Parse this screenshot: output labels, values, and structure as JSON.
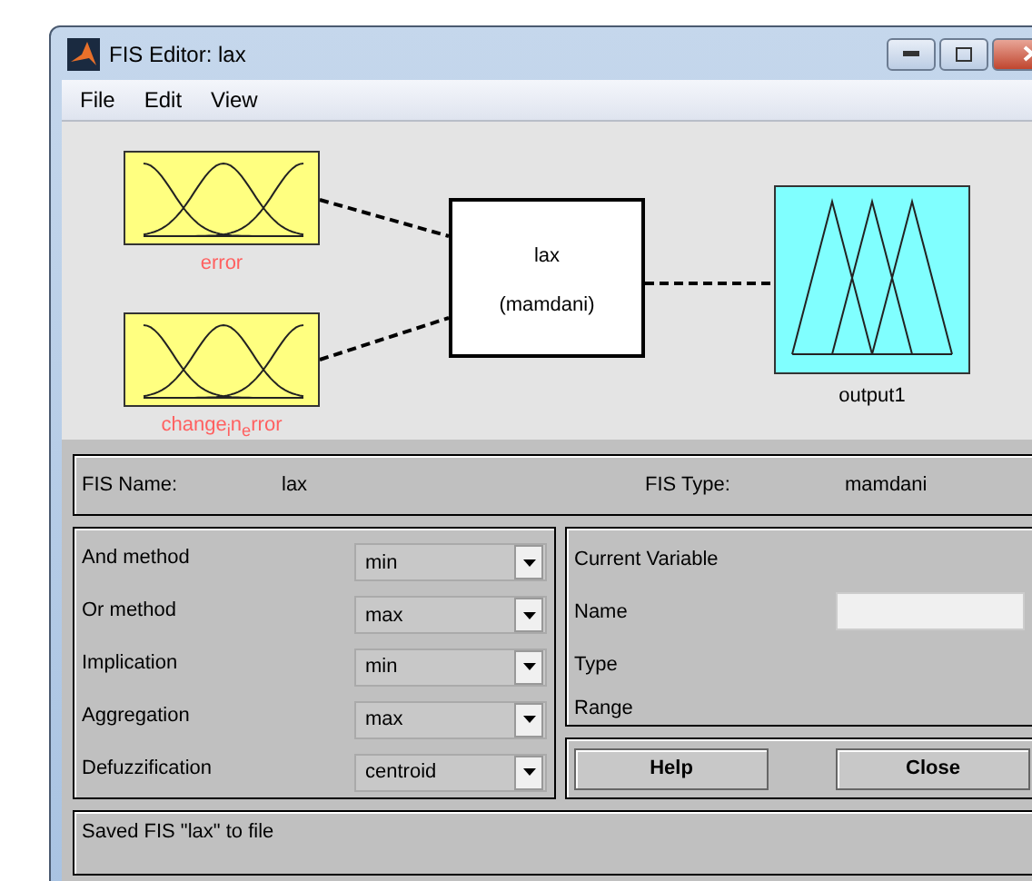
{
  "window": {
    "title": "FIS Editor: lax"
  },
  "menu": [
    "File",
    "Edit",
    "View"
  ],
  "diagram": {
    "inputs": [
      {
        "label": "error"
      },
      {
        "label": "change$_{i}$n$_{e}$rror"
      }
    ],
    "system": {
      "name": "lax",
      "type": "(mamdani)"
    },
    "output": {
      "label": "output1"
    }
  },
  "fis_info": {
    "name_label": "FIS Name:",
    "name": "lax",
    "type_label": "FIS Type:",
    "type": "mamdani"
  },
  "methods": [
    {
      "label": "And method",
      "value": "min"
    },
    {
      "label": "Or method",
      "value": "max"
    },
    {
      "label": "Implication",
      "value": "min"
    },
    {
      "label": "Aggregation",
      "value": "max"
    },
    {
      "label": "Defuzzification",
      "value": "centroid"
    }
  ],
  "current_variable": {
    "title": "Current Variable",
    "name_label": "Name",
    "type_label": "Type",
    "range_label": "Range"
  },
  "buttons": [
    "Help",
    "Close"
  ],
  "status": "Saved FIS \"lax\" to file"
}
